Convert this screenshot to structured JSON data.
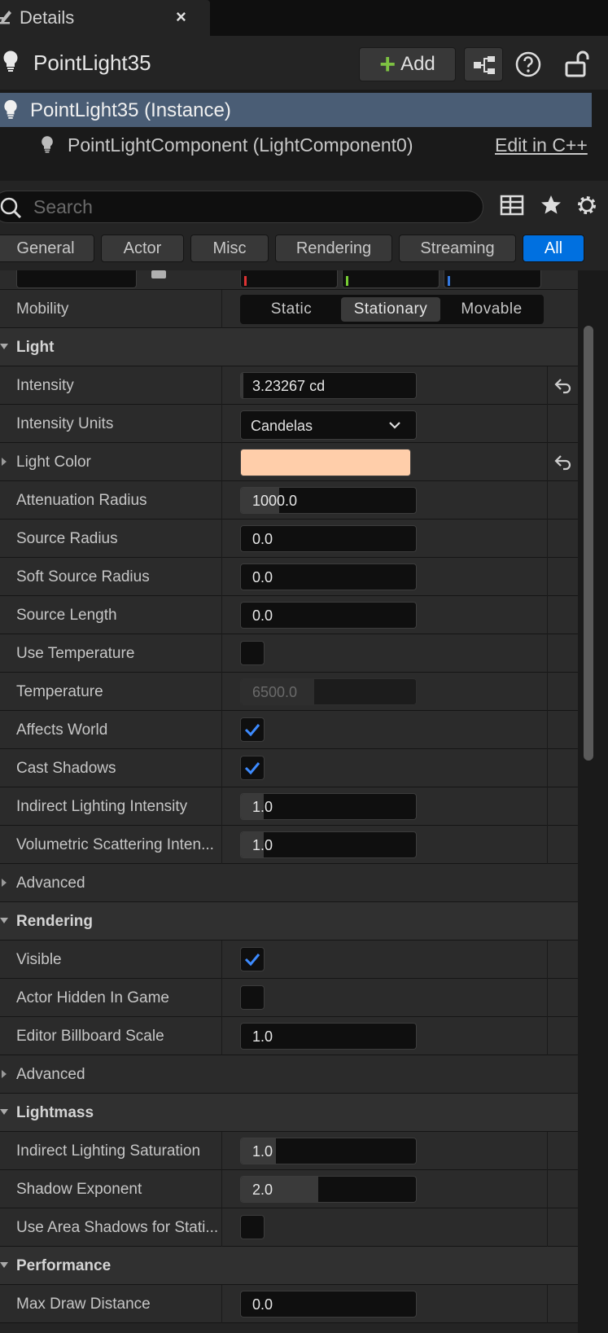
{
  "tab": {
    "title": "Details",
    "close": "×"
  },
  "actor": {
    "name": "PointLight35",
    "add_label": "Add",
    "add_plus": "+"
  },
  "components": {
    "instance": "PointLight35 (Instance)",
    "child": "PointLightComponent (LightComponent0)",
    "edit_link": "Edit in C++"
  },
  "search": {
    "placeholder": "Search"
  },
  "filters": [
    {
      "label": "General",
      "active": false
    },
    {
      "label": "Actor",
      "active": false
    },
    {
      "label": "Misc",
      "active": false
    },
    {
      "label": "Rendering",
      "active": false
    },
    {
      "label": "Streaming",
      "active": false
    },
    {
      "label": "All",
      "active": true
    }
  ],
  "colors": {
    "accent": "#0070e0",
    "selection": "#4a5d75",
    "light_color": "#ffceaa",
    "check": "#3d8bff",
    "add_green": "#7dc142"
  },
  "mobility": {
    "label": "Mobility",
    "options": [
      "Static",
      "Stationary",
      "Movable"
    ],
    "selected": "Stationary"
  },
  "light": {
    "header": "Light",
    "intensity": {
      "label": "Intensity",
      "value": "3.23267 cd"
    },
    "intensity_units": {
      "label": "Intensity Units",
      "value": "Candelas"
    },
    "light_color": {
      "label": "Light Color"
    },
    "attenuation_radius": {
      "label": "Attenuation Radius",
      "value": "1000.0",
      "fill": 0.22
    },
    "source_radius": {
      "label": "Source Radius",
      "value": "0.0"
    },
    "soft_source_radius": {
      "label": "Soft Source Radius",
      "value": "0.0"
    },
    "source_length": {
      "label": "Source Length",
      "value": "0.0"
    },
    "use_temperature": {
      "label": "Use Temperature",
      "checked": false
    },
    "temperature": {
      "label": "Temperature",
      "value": "6500.0",
      "fill": 0.42
    },
    "affects_world": {
      "label": "Affects World",
      "checked": true
    },
    "cast_shadows": {
      "label": "Cast Shadows",
      "checked": true
    },
    "indirect_intensity": {
      "label": "Indirect Lighting Intensity",
      "value": "1.0",
      "fill": 0.13
    },
    "volumetric": {
      "label": "Volumetric Scattering Inten...",
      "value": "1.0",
      "fill": 0.13
    },
    "advanced": "Advanced"
  },
  "rendering": {
    "header": "Rendering",
    "visible": {
      "label": "Visible",
      "checked": true
    },
    "hidden_in_game": {
      "label": "Actor Hidden In Game",
      "checked": false
    },
    "billboard_scale": {
      "label": "Editor Billboard Scale",
      "value": "1.0"
    },
    "advanced": "Advanced"
  },
  "lightmass": {
    "header": "Lightmass",
    "indirect_saturation": {
      "label": "Indirect Lighting Saturation",
      "value": "1.0",
      "fill": 0.2
    },
    "shadow_exponent": {
      "label": "Shadow Exponent",
      "value": "2.0",
      "fill": 0.44
    },
    "use_area_shadows": {
      "label": "Use Area Shadows for Stati...",
      "checked": false
    }
  },
  "performance": {
    "header": "Performance",
    "max_draw_distance": {
      "label": "Max Draw Distance",
      "value": "0.0"
    }
  }
}
